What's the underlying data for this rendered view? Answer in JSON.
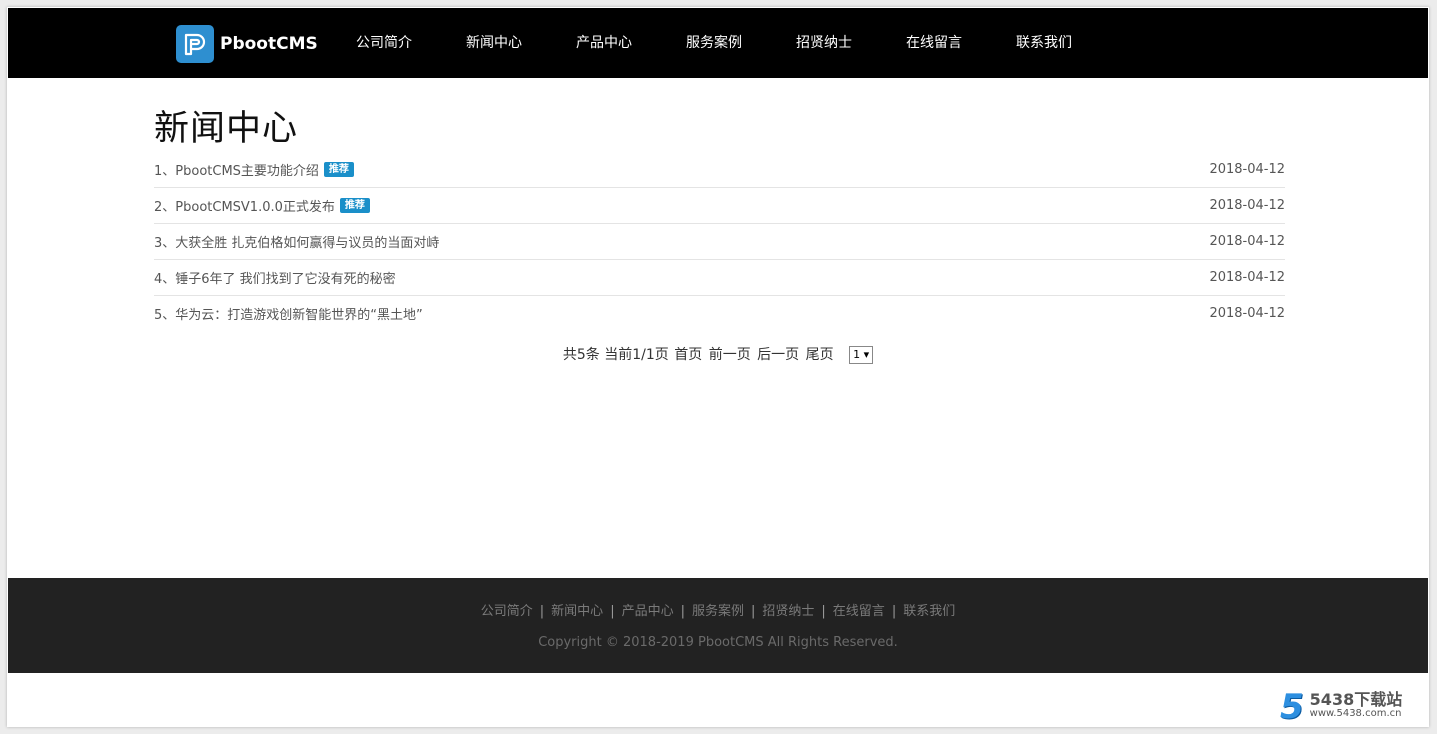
{
  "header": {
    "brand": "PbootCMS",
    "nav": [
      "公司简介",
      "新闻中心",
      "产品中心",
      "服务案例",
      "招贤纳士",
      "在线留言",
      "联系我们"
    ]
  },
  "main": {
    "title": "新闻中心",
    "news": [
      {
        "title": "1、PbootCMS主要功能介绍",
        "badge": "推荐",
        "date": "2018-04-12"
      },
      {
        "title": "2、PbootCMSV1.0.0正式发布",
        "badge": "推荐",
        "date": "2018-04-12"
      },
      {
        "title": "3、大获全胜 扎克伯格如何赢得与议员的当面对峙",
        "badge": "",
        "date": "2018-04-12"
      },
      {
        "title": "4、锤子6年了 我们找到了它没有死的秘密",
        "badge": "",
        "date": "2018-04-12"
      },
      {
        "title": "5、华为云：打造游戏创新智能世界的“黑土地”",
        "badge": "",
        "date": "2018-04-12"
      }
    ],
    "pager": {
      "total": "共5条",
      "current": "当前1/1页",
      "first": "首页",
      "prev": "前一页",
      "next": "后一页",
      "last": "尾页",
      "select_value": "1"
    }
  },
  "footer": {
    "links": [
      "公司简介",
      "新闻中心",
      "产品中心",
      "服务案例",
      "招贤纳士",
      "在线留言",
      "联系我们"
    ],
    "separator": "|",
    "copyright": "Copyright © 2018-2019 PbootCMS All Rights Reserved."
  },
  "watermark": {
    "logo_digit": "5",
    "name": "5438下载站",
    "url": "www.5438.com.cn"
  },
  "colors": {
    "header_bg": "#000000",
    "footer_bg": "#222222",
    "badge_bg": "#1a8fc9",
    "logo_bg": "#2e8fd0"
  }
}
